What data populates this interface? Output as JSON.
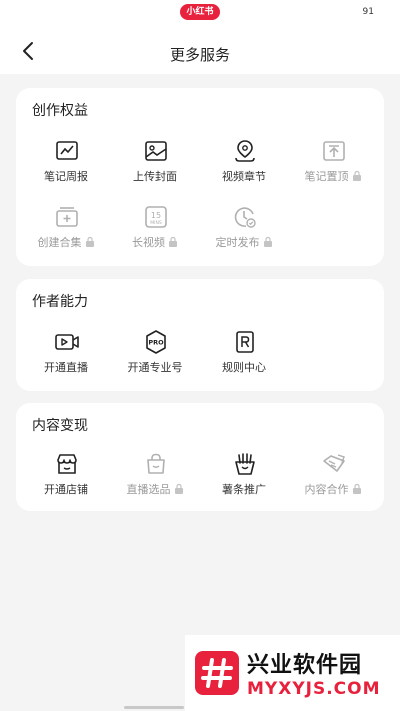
{
  "status_bar": {
    "app_badge": "小红书",
    "battery": "91"
  },
  "header": {
    "title": "更多服务"
  },
  "sections": [
    {
      "title": "创作权益",
      "items": [
        {
          "label": "笔记周报",
          "icon": "chart-icon",
          "locked": false
        },
        {
          "label": "上传封面",
          "icon": "image-icon",
          "locked": false
        },
        {
          "label": "视频章节",
          "icon": "location-pin-icon",
          "locked": false
        },
        {
          "label": "笔记置顶",
          "icon": "pin-top-icon",
          "locked": true
        },
        {
          "label": "创建合集",
          "icon": "collection-icon",
          "locked": true
        },
        {
          "label": "长视频",
          "icon": "fifteen-mins-icon",
          "locked": true
        },
        {
          "label": "定时发布",
          "icon": "scheduled-clock-icon",
          "locked": true
        }
      ]
    },
    {
      "title": "作者能力",
      "items": [
        {
          "label": "开通直播",
          "icon": "live-play-icon",
          "locked": false
        },
        {
          "label": "开通专业号",
          "icon": "pro-badge-icon",
          "locked": false
        },
        {
          "label": "规则中心",
          "icon": "rules-book-icon",
          "locked": false
        }
      ]
    },
    {
      "title": "内容变现",
      "items": [
        {
          "label": "开通店铺",
          "icon": "store-icon",
          "locked": false
        },
        {
          "label": "直播选品",
          "icon": "shopping-bag-icon",
          "locked": true
        },
        {
          "label": "薯条推广",
          "icon": "fries-icon",
          "locked": false
        },
        {
          "label": "内容合作",
          "icon": "handshake-icon",
          "locked": true
        }
      ]
    }
  ],
  "watermark": {
    "cn": "兴业软件园",
    "en": "MYXYJS.COM"
  },
  "colors": {
    "accent": "#e8213d",
    "icon_active": "#222222",
    "icon_locked": "#b0b0b0"
  }
}
